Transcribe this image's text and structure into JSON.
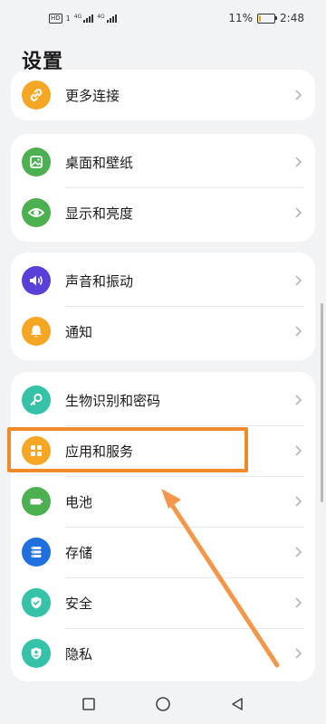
{
  "status": {
    "hd": "HD",
    "sim1_tag": "4G",
    "sim2_tag": "4G",
    "battery_percent": "11%",
    "battery_level": 0.11,
    "time": "2:48"
  },
  "page": {
    "title": "设置"
  },
  "groups": [
    {
      "items": [
        {
          "label": "更多连接",
          "icon": "link-icon",
          "color": "#f5a623"
        }
      ]
    },
    {
      "items": [
        {
          "label": "桌面和壁纸",
          "icon": "wallpaper-icon",
          "color": "#4cb050"
        },
        {
          "label": "显示和亮度",
          "icon": "eye-icon",
          "color": "#4cb050"
        }
      ]
    },
    {
      "items": [
        {
          "label": "声音和振动",
          "icon": "speaker-icon",
          "color": "#5b3fd9"
        },
        {
          "label": "通知",
          "icon": "bell-icon",
          "color": "#f5a623"
        }
      ]
    },
    {
      "items": [
        {
          "label": "生物识别和密码",
          "icon": "key-icon",
          "color": "#35c2a8"
        },
        {
          "label": "应用和服务",
          "icon": "apps-icon",
          "color": "#f5a623"
        },
        {
          "label": "电池",
          "icon": "battery-icon",
          "color": "#4cb050"
        },
        {
          "label": "存储",
          "icon": "storage-icon",
          "color": "#1f6fe0"
        },
        {
          "label": "安全",
          "icon": "shield-check-icon",
          "color": "#35c2a8"
        },
        {
          "label": "隐私",
          "icon": "privacy-icon",
          "color": "#35c2a8"
        }
      ]
    }
  ],
  "annotation": {
    "highlight_color": "#f08a2c",
    "arrow_color": "#f5974a"
  },
  "navbar": {
    "back": "back-icon",
    "home": "home-icon",
    "recent": "recent-icon"
  }
}
